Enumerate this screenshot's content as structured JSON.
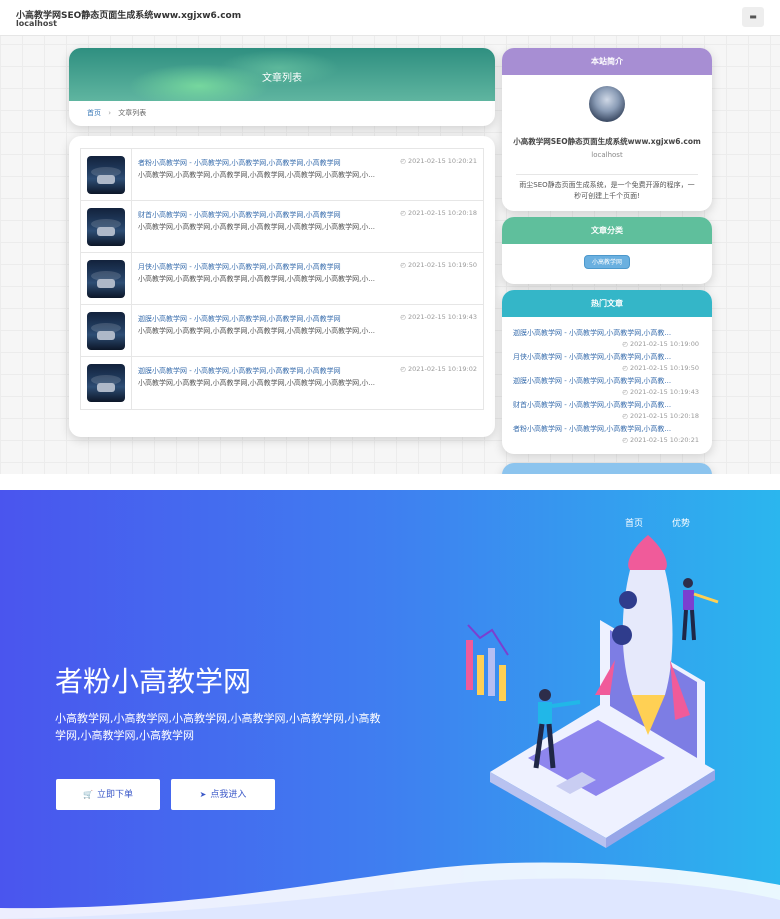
{
  "header": {
    "title": "小高教学网SEO静态页面生成系统www.xgjxw6.com",
    "subtitle": "localhost",
    "menu_icon": "menu-icon"
  },
  "main": {
    "banner_title": "文章列表",
    "breadcrumb": {
      "home": "首页",
      "separator": "›",
      "current": "文章列表"
    },
    "articles": [
      {
        "title": "者粉小高教学网 - 小高教学网,小高教学网,小高教学网,小高教学网",
        "date": "2021-02-15 10:20:21",
        "desc": "小高教学网,小高教学网,小高教学网,小高教学网,小高教学网,小高教学网,小..."
      },
      {
        "title": "财首小高教学网 - 小高教学网,小高教学网,小高教学网,小高教学网",
        "date": "2021-02-15 10:20:18",
        "desc": "小高教学网,小高教学网,小高教学网,小高教学网,小高教学网,小高教学网,小..."
      },
      {
        "title": "月侠小高教学网 - 小高教学网,小高教学网,小高教学网,小高教学网",
        "date": "2021-02-15 10:19:50",
        "desc": "小高教学网,小高教学网,小高教学网,小高教学网,小高教学网,小高教学网,小..."
      },
      {
        "title": "迦膜小高教学网 - 小高教学网,小高教学网,小高教学网,小高教学网",
        "date": "2021-02-15 10:19:43",
        "desc": "小高教学网,小高教学网,小高教学网,小高教学网,小高教学网,小高教学网,小..."
      },
      {
        "title": "迦膜小高教学网 - 小高教学网,小高教学网,小高教学网,小高教学网",
        "date": "2021-02-15 10:19:02",
        "desc": "小高教学网,小高教学网,小高教学网,小高教学网,小高教学网,小高教学网,小..."
      }
    ]
  },
  "sidebar": {
    "about": {
      "heading": "本站简介",
      "site_name": "小高教学网SEO静态页面生成系统www.xgjxw6.com",
      "host": "localhost",
      "desc": "雨尘SEO静态页面生成系统，是一个免费开源的程序，一秒可创建上千个页面!",
      "color": "#a78ed3"
    },
    "categories": {
      "heading": "文章分类",
      "tag": "小高教学网",
      "color": "#5fbf9c"
    },
    "hot": {
      "heading": "热门文章",
      "color": "#34b6c8",
      "items": [
        {
          "title": "迦膜小高教学网 - 小高教学网,小高教学网,小高教...",
          "date": "2021-02-15 10:19:00"
        },
        {
          "title": "月侠小高教学网 - 小高教学网,小高教学网,小高教...",
          "date": "2021-02-15 10:19:50"
        },
        {
          "title": "迦膜小高教学网 - 小高教学网,小高教学网,小高教...",
          "date": "2021-02-15 10:19:43"
        },
        {
          "title": "财首小高教学网 - 小高教学网,小高教学网,小高教...",
          "date": "2021-02-15 10:20:18"
        },
        {
          "title": "者粉小高教学网 - 小高教学网,小高教学网,小高教...",
          "date": "2021-02-15 10:20:21"
        }
      ]
    }
  },
  "hero": {
    "nav": [
      "首页",
      "优势"
    ],
    "heading": "者粉小高教学网",
    "desc": "小高教学网,小高教学网,小高教学网,小高教学网,小高教学网,小高教学网,小高教学网,小高教学网",
    "buttons": [
      {
        "label": "立即下单",
        "icon": "cart-icon"
      },
      {
        "label": "点我进入",
        "icon": "cursor-icon"
      }
    ]
  }
}
